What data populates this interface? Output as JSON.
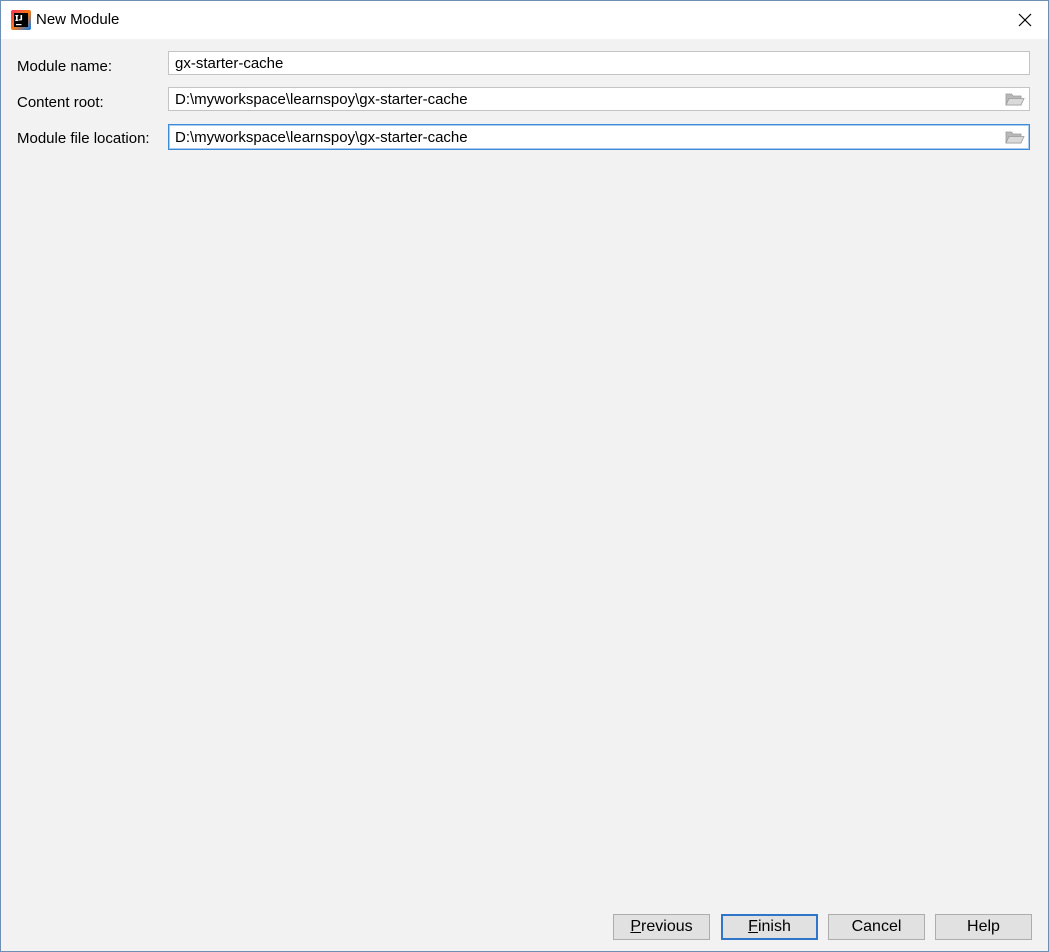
{
  "window": {
    "title": "New Module",
    "app_icon": "intellij-idea-icon",
    "close_icon": "close-icon"
  },
  "form": {
    "module_name": {
      "label": "Module name:",
      "value": "gx-starter-cache"
    },
    "content_root": {
      "label": "Content root:",
      "value": "D:\\myworkspace\\learnspoy\\gx-starter-cache",
      "browse_icon": "folder-open-icon"
    },
    "module_file_location": {
      "label": "Module file location:",
      "value": "D:\\myworkspace\\learnspoy\\gx-starter-cache",
      "browse_icon": "folder-open-icon"
    }
  },
  "buttons": {
    "previous": {
      "mnemonic": "P",
      "rest": "revious"
    },
    "finish": {
      "mnemonic": "F",
      "rest": "inish"
    },
    "cancel": {
      "label": "Cancel"
    },
    "help": {
      "label": "Help"
    }
  },
  "colors": {
    "focus_border": "#3d8ad6",
    "default_button_border": "#2f76c9",
    "background": "#f2f2f2"
  }
}
